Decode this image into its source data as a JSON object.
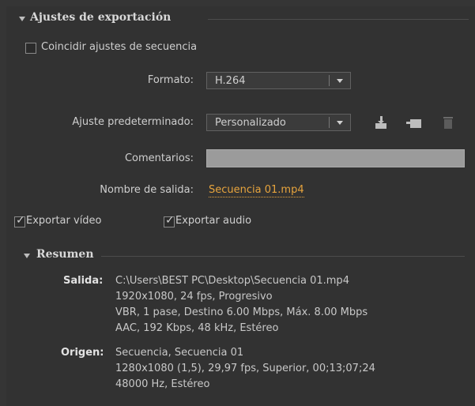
{
  "export": {
    "title": "Ajustes de exportación",
    "match_sequence_label": "Coincidir ajustes de secuencia",
    "format_label": "Formato:",
    "format_value": "H.264",
    "preset_label": "Ajuste predeterminado:",
    "preset_value": "Personalizado",
    "comments_label": "Comentarios:",
    "comments_value": "",
    "output_name_label": "Nombre de salida:",
    "output_name_value": "Secuencia 01.mp4",
    "export_video_label": "Exportar vídeo",
    "export_audio_label": "Exportar audio"
  },
  "summary": {
    "title": "Resumen",
    "output_label": "Salida:",
    "output_lines": [
      "C:\\Users\\BEST PC\\Desktop\\Secuencia 01.mp4",
      "1920x1080, 24 fps, Progresivo",
      "VBR, 1 pase, Destino 6.00 Mbps, Máx. 8.00 Mbps",
      "AAC, 192 Kbps, 48 kHz, Estéreo"
    ],
    "source_label": "Origen:",
    "source_lines": [
      "Secuencia, Secuencia 01",
      "1280x1080 (1,5), 29,97 fps, Superior, 00;13;07;24",
      "48000 Hz, Estéreo"
    ]
  },
  "icons": [
    "save-preset-icon",
    "import-preset-icon",
    "delete-preset-icon"
  ],
  "colors": {
    "link": "#e7a43d",
    "panel": "#353535"
  }
}
